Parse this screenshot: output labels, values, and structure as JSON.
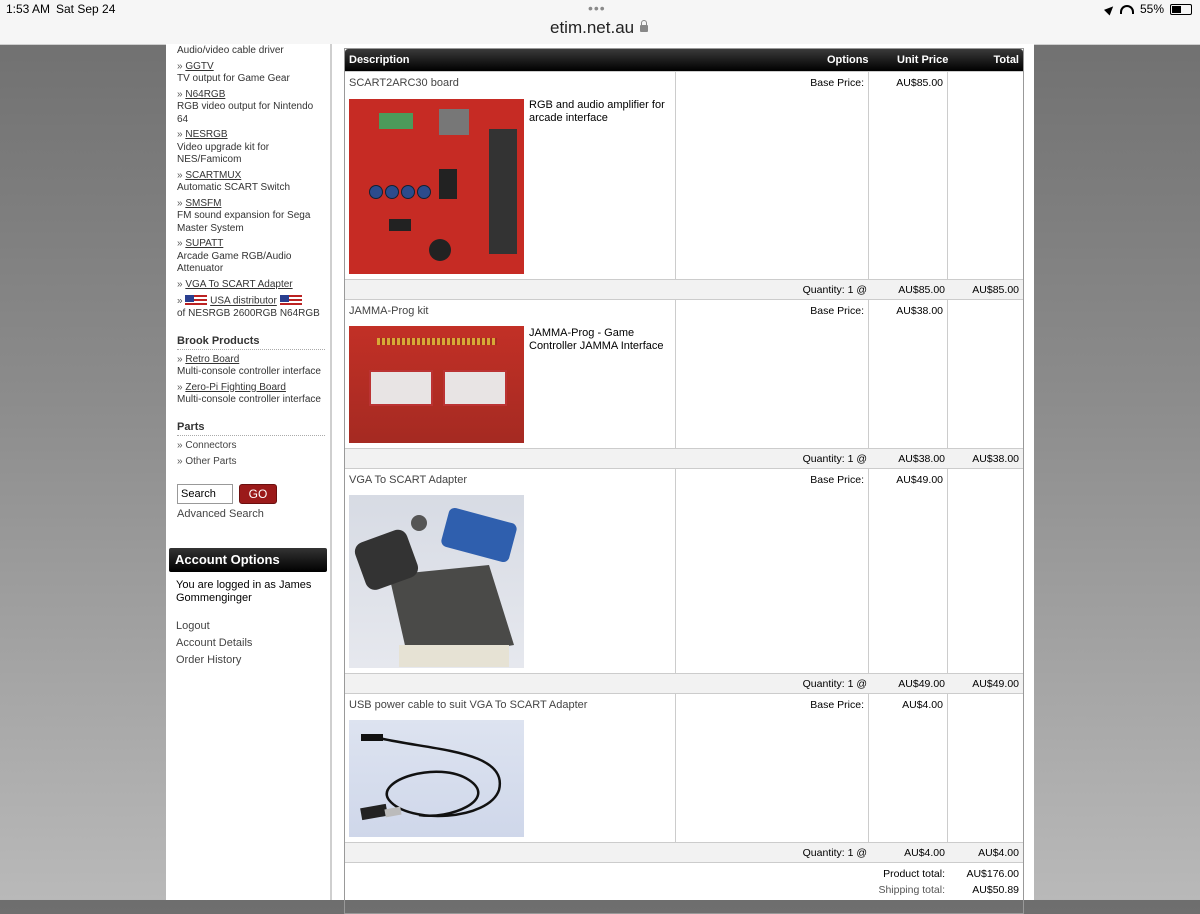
{
  "statusbar": {
    "time": "1:53 AM",
    "date": "Sat Sep 24",
    "url": "etim.net.au",
    "battery": "55%",
    "battery_level": 0.55
  },
  "sidebar": {
    "products": [
      {
        "name": "",
        "desc": "Audio/video cable driver"
      },
      {
        "name": "GGTV",
        "desc": "TV output for Game Gear"
      },
      {
        "name": "N64RGB",
        "desc": "RGB video output for Nintendo 64"
      },
      {
        "name": "NESRGB",
        "desc": "Video upgrade kit for NES/Famicom"
      },
      {
        "name": "SCARTMUX",
        "desc": "Automatic SCART Switch"
      },
      {
        "name": "SMSFM",
        "desc": "FM sound expansion for Sega Master System"
      },
      {
        "name": "SUPATT",
        "desc": "Arcade Game RGB/Audio Attenuator"
      },
      {
        "name": "VGA To SCART Adapter",
        "desc": ""
      }
    ],
    "us_distributor": {
      "name": "USA distributor",
      "desc": "of NESRGB 2600RGB N64RGB"
    },
    "brook": {
      "title": "Brook Products",
      "items": [
        {
          "name": "Retro Board",
          "desc": "Multi-console controller interface"
        },
        {
          "name": "Zero-Pi Fighting Board",
          "desc": "Multi-console controller interface"
        }
      ]
    },
    "parts": {
      "title": "Parts",
      "items": [
        "Connectors",
        "Other Parts"
      ]
    },
    "search": {
      "value": "Search",
      "go": "GO",
      "advanced": "Advanced Search"
    },
    "account": {
      "title": "Account Options",
      "logged_in": "You are logged in as James Gommenginger",
      "links": [
        "Logout",
        "Account Details",
        "Order History"
      ]
    }
  },
  "cart": {
    "headers": {
      "description": "Description",
      "options": "Options",
      "unit_price": "Unit Price",
      "total": "Total"
    },
    "items": [
      {
        "name": "SCART2ARC30 board",
        "text": "RGB and audio amplifier for arcade interface",
        "base_label": "Base Price:",
        "unit_price": "AU$85.00",
        "qty_label": "Quantity: 1 @",
        "qty_unit": "AU$85.00",
        "total": "AU$85.00"
      },
      {
        "name": "JAMMA-Prog kit",
        "text": "JAMMA-Prog - Game Controller JAMMA Interface",
        "base_label": "Base Price:",
        "unit_price": "AU$38.00",
        "qty_label": "Quantity: 1 @",
        "qty_unit": "AU$38.00",
        "total": "AU$38.00"
      },
      {
        "name": "VGA To SCART Adapter",
        "text": "",
        "base_label": "Base Price:",
        "unit_price": "AU$49.00",
        "qty_label": "Quantity: 1 @",
        "qty_unit": "AU$49.00",
        "total": "AU$49.00"
      },
      {
        "name": "USB power cable to suit VGA To SCART Adapter",
        "text": "",
        "base_label": "Base Price:",
        "unit_price": "AU$4.00",
        "qty_label": "Quantity: 1 @",
        "qty_unit": "AU$4.00",
        "total": "AU$4.00"
      }
    ],
    "product_total_label": "Product total:",
    "product_total": "AU$176.00",
    "shipping_total_label": "Shipping total:",
    "shipping_total": "AU$50.89"
  }
}
